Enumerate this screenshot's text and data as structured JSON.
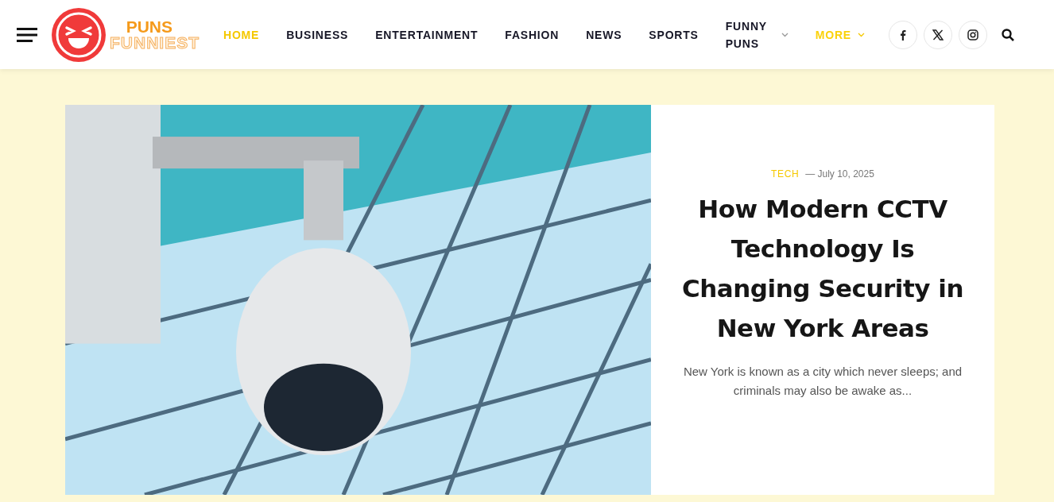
{
  "logo": {
    "line_1": "PUNS",
    "line_2": "FUNNIEST"
  },
  "nav": [
    {
      "label": "HOME",
      "kind": "link",
      "selected": true
    },
    {
      "label": "BUSINESS",
      "kind": "link",
      "selected": false
    },
    {
      "label": "ENTERTAINMENT",
      "kind": "link",
      "selected": false
    },
    {
      "label": "FASHION",
      "kind": "link",
      "selected": false
    },
    {
      "label": "NEWS",
      "kind": "link",
      "selected": false
    },
    {
      "label": "SPORTS",
      "kind": "link",
      "selected": false
    },
    {
      "label": "FUNNY PUNS",
      "kind": "dropdown",
      "selected": false
    },
    {
      "label": "MORE",
      "kind": "accent-dropdown",
      "selected": false
    }
  ],
  "social": [
    {
      "kind": "facebook"
    },
    {
      "kind": "x"
    },
    {
      "kind": "instagram"
    }
  ],
  "featured": {
    "category": "TECH",
    "date": "— July 10, 2025",
    "title": "How Modern CCTV Technology Is Changing Security in New York Areas",
    "excerpt": "New York is known as a city which never sleeps; and criminals may also be awake as..."
  }
}
